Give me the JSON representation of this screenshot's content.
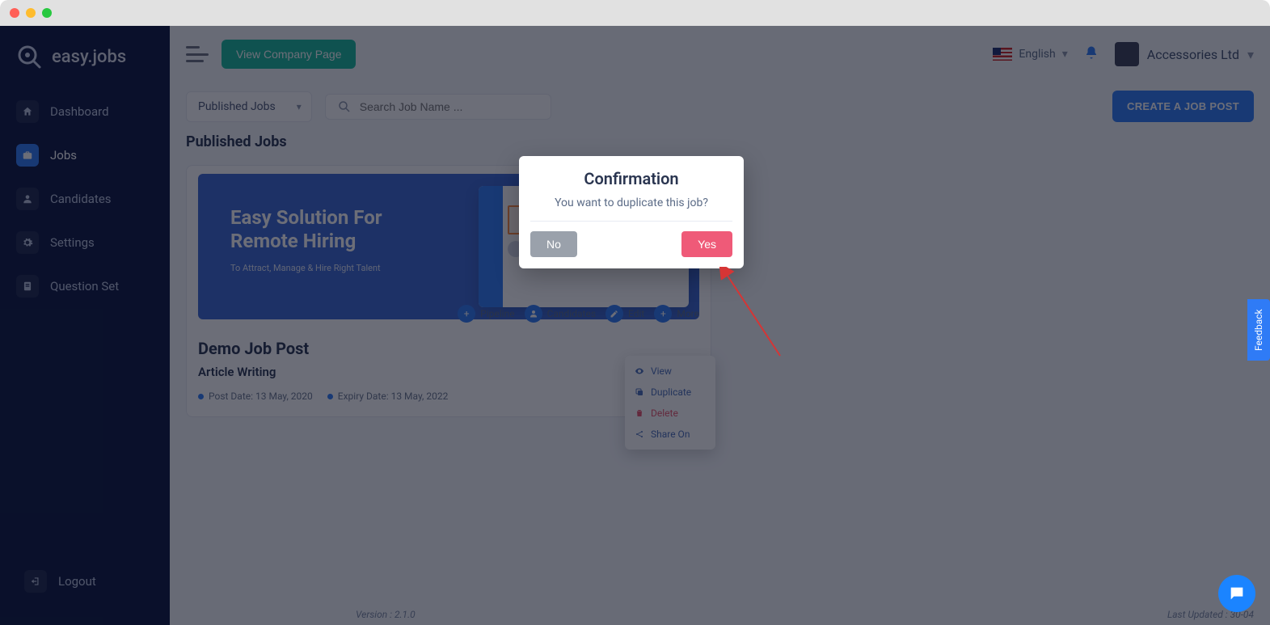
{
  "brand": "easy.jobs",
  "sidebar": {
    "items": [
      {
        "label": "Dashboard"
      },
      {
        "label": "Jobs"
      },
      {
        "label": "Candidates"
      },
      {
        "label": "Settings"
      },
      {
        "label": "Question Set"
      }
    ],
    "logout": "Logout"
  },
  "topbar": {
    "view_company": "View Company Page",
    "language": "English",
    "company": "Accessories Ltd"
  },
  "filter": {
    "selected": "Published Jobs",
    "search_placeholder": "Search Job Name ...",
    "create_btn": "CREATE A JOB POST"
  },
  "section_title": "Published Jobs",
  "job_card": {
    "banner_title_1": "Easy Solution For",
    "banner_title_2": "Remote Hiring",
    "banner_sub": "To Attract, Manage & Hire Right Talent",
    "actions": {
      "pipeline": "Pipeline",
      "candidates": "Candidates",
      "edit": "Edit",
      "more": "More"
    },
    "title": "Demo Job Post",
    "category": "Article Writing",
    "post_date": "Post Date: 13 May, 2020",
    "expiry_date": "Expiry Date: 13 May, 2022"
  },
  "dropdown": {
    "view": "View",
    "duplicate": "Duplicate",
    "delete": "Delete",
    "share": "Share On"
  },
  "modal": {
    "title": "Confirmation",
    "text": "You want to duplicate this job?",
    "no": "No",
    "yes": "Yes"
  },
  "feedback": "Feedback",
  "footer": {
    "version": "Version : 2.1.0",
    "updated": "Last Updated : 30-04"
  }
}
